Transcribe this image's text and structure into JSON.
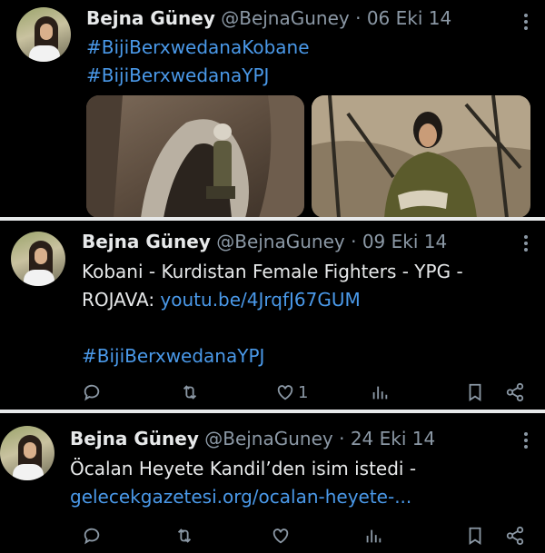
{
  "tweets": [
    {
      "name": "Bejna Güney",
      "handle": "@BejnaGuney",
      "dot": "·",
      "date": "06 Eki 14",
      "more": "⋮",
      "hashtags": [
        "#BijiBerxwedanaKobane",
        "#BijiBerxwedanaYPJ"
      ]
    },
    {
      "name": "Bejna Güney",
      "handle": "@BejnaGuney",
      "dot": "·",
      "date": "09 Eki 14",
      "more": "⋮",
      "text_line1": "Kobani - Kurdistan Female Fighters - YPG -",
      "text_line2_prefix": "ROJAVA: ",
      "link": "youtu.be/4JrqfJ67GUM",
      "hashtag": "#BijiBerxwedanaYPJ",
      "like_count": "1"
    },
    {
      "name": "Bejna Güney",
      "handle": "@BejnaGuney",
      "dot": "·",
      "date": "24 Eki 14",
      "more": "⋮",
      "text_line1": "Öcalan Heyete Kandil’den isim istedi -",
      "link": "gelecekgazetesi.org/ocalan-heyete-..."
    }
  ],
  "colors": {
    "link": "#4a99e9",
    "muted": "#8b98a5",
    "text": "#e7e9ea",
    "background": "#000000"
  },
  "icons": [
    "reply-icon",
    "retweet-icon",
    "like-icon",
    "views-icon",
    "bookmark-icon",
    "share-icon",
    "more-icon"
  ]
}
